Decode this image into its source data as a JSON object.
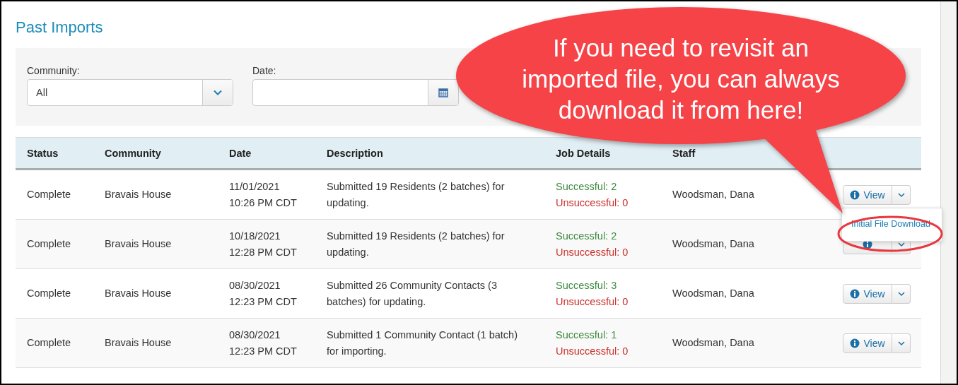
{
  "title": "Past Imports",
  "filters": [
    {
      "label": "Community:",
      "kind": "select",
      "value": "All"
    },
    {
      "label": "Date:",
      "kind": "date"
    }
  ],
  "table": {
    "columns": [
      "Status",
      "Community",
      "Date",
      "Description",
      "Job Details",
      "Staff"
    ],
    "rows": [
      {
        "status": "Complete",
        "community": "Bravais House",
        "date": "11/01/2021",
        "time": "10:26 PM CDT",
        "description": "Submitted 19 Residents (2 batches) for updating.",
        "successful": "Successful: 2",
        "unsuccessful": "Unsuccessful: 0",
        "staff": "Woodsman, Dana",
        "view_label": "View",
        "menu_open": true,
        "menu": [
          "Initial File Download"
        ]
      },
      {
        "status": "Complete",
        "community": "Bravais House",
        "date": "10/18/2021",
        "time": "12:28 PM CDT",
        "description": "Submitted 19 Residents (2 batches) for updating.",
        "successful": "Successful: 2",
        "unsuccessful": "Unsuccessful: 0",
        "staff": "Woodsman, Dana",
        "menu_open": false
      },
      {
        "status": "Complete",
        "community": "Bravais House",
        "date": "08/30/2021",
        "time": "12:23 PM CDT",
        "description": "Submitted 26 Community Contacts (3 batches) for updating.",
        "successful": "Successful: 3",
        "unsuccessful": "Unsuccessful: 0",
        "staff": "Woodsman, Dana",
        "view_label": "View",
        "menu_open": false
      },
      {
        "status": "Complete",
        "community": "Bravais House",
        "date": "08/30/2021",
        "time": "12:23 PM CDT",
        "description": "Submitted 1 Community Contact (1 batch) for importing.",
        "successful": "Successful: 1",
        "unsuccessful": "Unsuccessful: 0",
        "staff": "Woodsman, Dana",
        "view_label": "View",
        "menu_open": false
      }
    ]
  },
  "callout": {
    "text": "If you need to revisit an imported file, you can always download it from here!"
  }
}
